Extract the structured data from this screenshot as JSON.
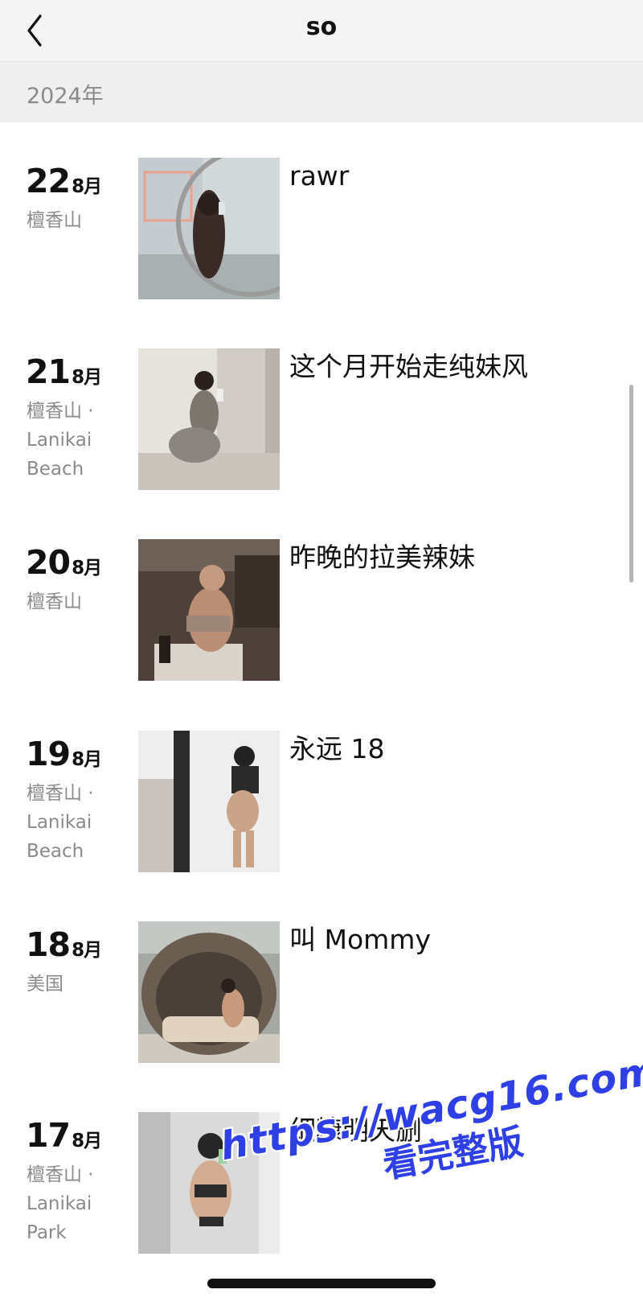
{
  "header": {
    "title": "so"
  },
  "year_header": "2024年",
  "entries": [
    {
      "day": "22",
      "month": "8月",
      "location": "檀香山",
      "caption": "rawr",
      "thumb_colors": {
        "bg": "#cfd4d6",
        "accent": "#8e9aa3",
        "figure": "#3a2b26"
      }
    },
    {
      "day": "21",
      "month": "8月",
      "location": "檀香山 · Lanikai Beach",
      "caption": "这个月开始走纯妹风",
      "thumb_colors": {
        "bg": "#e6e2dc",
        "accent": "#b5aca2",
        "figure": "#8b8580"
      }
    },
    {
      "day": "20",
      "month": "8月",
      "location": "檀香山",
      "caption": "昨晚的拉美辣妹",
      "thumb_colors": {
        "bg": "#5a4a3f",
        "accent": "#2a221d",
        "figure": "#b98e74"
      }
    },
    {
      "day": "19",
      "month": "8月",
      "location": "檀香山 · Lanikai Beach",
      "caption": "永远 18",
      "thumb_colors": {
        "bg": "#ededed",
        "accent": "#c9c3bf",
        "figure": "#242424"
      }
    },
    {
      "day": "18",
      "month": "8月",
      "location": "美国",
      "caption": "叫 Mommy",
      "thumb_colors": {
        "bg": "#9a9c96",
        "accent": "#6b5e50",
        "figure": "#e1d3c0"
      }
    },
    {
      "day": "17",
      "month": "8月",
      "location": "檀香山 · Lanikai Park",
      "caption": "细糠明天删",
      "thumb_colors": {
        "bg": "#d8d8d8",
        "accent": "#a8a8a8",
        "figure": "#2c2c2c"
      }
    }
  ],
  "watermark": {
    "url": "https://wacg16.com",
    "text": "看完整版",
    "color": "#2f3fe6"
  }
}
